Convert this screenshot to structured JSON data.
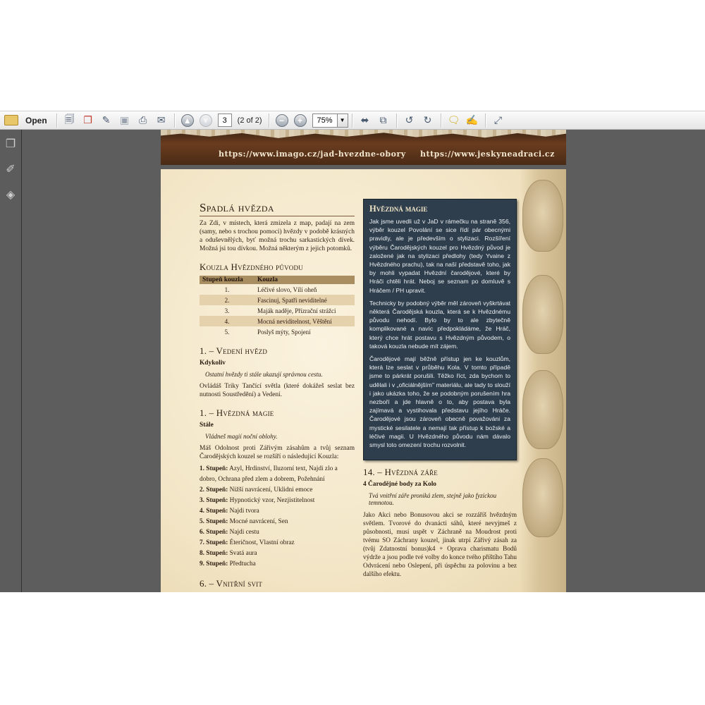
{
  "toolbar": {
    "open_label": "Open",
    "page_current": "3",
    "page_of": "(2 of 2)",
    "zoom": "75%",
    "icons": [
      "open-folder-icon",
      "create-pdf-icon",
      "export-icon",
      "edit-icon",
      "save-icon",
      "print-icon",
      "email-icon",
      "prev-page-icon",
      "next-page-icon",
      "zoom-out-icon",
      "zoom-in-icon",
      "fit-width-icon",
      "fit-page-icon",
      "rotate-ccw-icon",
      "rotate-cw-icon",
      "comment-icon",
      "sign-icon",
      "expand-icon"
    ]
  },
  "sidebar": {
    "icons": [
      "pages-icon",
      "attachment-icon",
      "layers-icon"
    ]
  },
  "page1_footer": {
    "url_left": "https://www.imago.cz/jad-hvezdne-obory",
    "url_right": "https://www.jeskyneadraci.cz"
  },
  "left": {
    "title": "Spadlá hvězda",
    "intro": "Za Zdi, v místech, která zmizela z map, padají na zem (samy, nebo s trochou pomoci) hvězdy v podobě krásných a oduševnělých, byť možná trochu sarkastických dívek. Možná jsi tou dívkou. Možná některým z jejich potomků.",
    "spells_heading": "Kouzla Hvězdného původu",
    "spells_table": {
      "headers": [
        "Stupeň kouzla",
        "Kouzla"
      ],
      "rows": [
        [
          "1.",
          "Léčivé slovo, Vílí oheň"
        ],
        [
          "2.",
          "Fascinuj, Spatři neviditelné"
        ],
        [
          "3.",
          "Maják naděje, Přízrační strážci"
        ],
        [
          "4.",
          "Mocná neviditelnost, Věštění"
        ],
        [
          "5.",
          "Poslyš mýty, Spojení"
        ]
      ]
    },
    "s1_heading": "1. – Vedení hvězd",
    "s1_sub": "Kdykoliv",
    "s1_quote": "Ostatní hvězdy ti stále ukazují správnou cestu.",
    "s1_text": "Ovládáš Triky Tančící světla (které dokážeš seslat bez nutnosti Soustředění) a Vedení.",
    "s2_heading": "1. – Hvězdná magie",
    "s2_sub": "Stále",
    "s2_quote": "Vládneš magií noční oblohy.",
    "s2_text": "Máš Odolnost proti Zářivým zásahům a tvůj seznam Čarodějských kouzel se rozšíří o následující Kouzla:",
    "levels": [
      {
        "label": "1. Stupeň:",
        "text": " Azyl, Hrdinství, Iluzorní text, Najdi zlo a dobro, Ochrana před zlem a dobrem, Požehnání"
      },
      {
        "label": "2. Stupeň:",
        "text": " Nižší navrácení, Uklidni emoce"
      },
      {
        "label": "3. Stupeň:",
        "text": " Hypnotický vzor, Nezjistitelnost"
      },
      {
        "label": "4. Stupeň:",
        "text": " Najdi tvora"
      },
      {
        "label": "5. Stupeň:",
        "text": " Mocné navrácení, Sen"
      },
      {
        "label": "6. Stupeň:",
        "text": " Najdi cestu"
      },
      {
        "label": "7. Stupeň:",
        "text": " Éteričnost, Vlastní obraz"
      },
      {
        "label": "8. Stupeň:",
        "text": " Svatá aura"
      },
      {
        "label": "9. Stupeň:",
        "text": " Předtucha"
      }
    ],
    "s3_heading": "6. – Vnitřní svit"
  },
  "box": {
    "title": "Hvězdná magie",
    "p1": "Jak jsme uvedli už v JaD v rámečku na straně 356, výběr kouzel Povolání se sice řídí pár obecnými pravidly, ale je především o stylizaci. Rozšíření výběru Čarodějských kouzel pro Hvězdný původ je založené jak na stylizaci předlohy (tedy Yvaine z Hvězdného prachu), tak na naší představě toho, jak by mohli vypadat Hvězdní čarodějové, které by Hráči chtěli hrát. Neboj se seznam po domluvě s Hráčem / PH upravit.",
    "p2": "Technicky by podobný výběr měl zároveň vyškrtávat některá Čarodějská kouzla, která se k Hvězdnému původu nehodí. Bylo by to ale zbytečně komplikované a navíc předpokládáme, že Hráč, který chce hrát postavu s Hvězdným původem, o taková kouzla nebude mít zájem.",
    "p3": "Čarodějové mají běžně přístup jen ke kouzlům, která lze seslat v průběhu Kola. V tomto případě jsme to párkrát porušili. Těžko říct, zda bychom to udělali i v „oficiálnějším\" materiálu, ale tady to slouží i jako ukázka toho, že se podobným porušením hra nezboří a jde hlavně o to, aby postava byla zajímavá a vystihovala představu jejího Hráče. Čarodějové jsou zároveň obecně považováni za mystické sesilatele a nemají tak přístup k božské a léčivé magii. U Hvězdného původu nám dávalo smysl toto omezení trochu rozvolnit."
  },
  "right": {
    "heading": "14. – Hvězdná záře",
    "sub": "4 Čarodějné body za Kolo",
    "quote": "Tvá vnitřní záře proniká zlem, stejně jako fyzickou temnotou.",
    "text": "Jako Akci nebo Bonusovou akci se rozzáříš hvězdným světlem. Tvorové do dvanácti sáhů, které nevyjmeš z působnosti, musí uspět v Záchraně na Moudrost proti tvému SO Záchrany kouzel, jinak utrpí Zářivý zásah za (tvůj Zdatnostní bonus)k4 + Oprava charismatu Bodů výdrže a jsou podle tvé volby do konce tvého příštího Tahu Odvrácení nebo Oslepení, při úspěchu za polovinu a bez dalšího efektu."
  }
}
